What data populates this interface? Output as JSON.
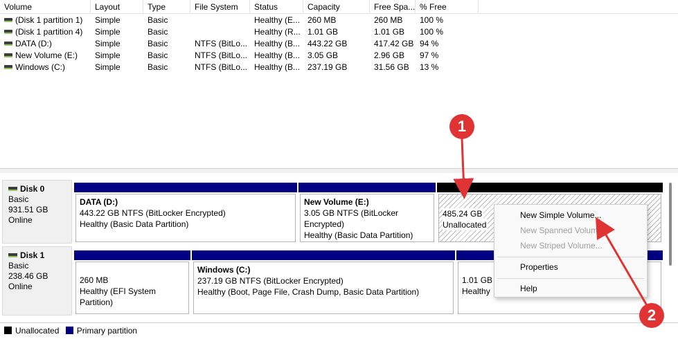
{
  "columns": [
    "Volume",
    "Layout",
    "Type",
    "File System",
    "Status",
    "Capacity",
    "Free Spa...",
    "% Free"
  ],
  "volumes": [
    {
      "volume": "(Disk 1 partition 1)",
      "layout": "Simple",
      "type": "Basic",
      "fs": "",
      "status": "Healthy (E...",
      "capacity": "260 MB",
      "free": "260 MB",
      "pct": "100 %"
    },
    {
      "volume": "(Disk 1 partition 4)",
      "layout": "Simple",
      "type": "Basic",
      "fs": "",
      "status": "Healthy (R...",
      "capacity": "1.01 GB",
      "free": "1.01 GB",
      "pct": "100 %"
    },
    {
      "volume": "DATA (D:)",
      "layout": "Simple",
      "type": "Basic",
      "fs": "NTFS (BitLo...",
      "status": "Healthy (B...",
      "capacity": "443.22 GB",
      "free": "417.42 GB",
      "pct": "94 %"
    },
    {
      "volume": "New Volume (E:)",
      "layout": "Simple",
      "type": "Basic",
      "fs": "NTFS (BitLo...",
      "status": "Healthy (B...",
      "capacity": "3.05 GB",
      "free": "2.96 GB",
      "pct": "97 %"
    },
    {
      "volume": "Windows (C:)",
      "layout": "Simple",
      "type": "Basic",
      "fs": "NTFS (BitLo...",
      "status": "Healthy (B...",
      "capacity": "237.19 GB",
      "free": "31.56 GB",
      "pct": "13 %"
    }
  ],
  "disk0": {
    "name": "Disk 0",
    "type": "Basic",
    "size": "931.51 GB",
    "state": "Online",
    "partitions": [
      {
        "title": "DATA  (D:)",
        "line1": "443.22 GB NTFS (BitLocker Encrypted)",
        "line2": "Healthy (Basic Data Partition)"
      },
      {
        "title": "New Volume  (E:)",
        "line1": "3.05 GB NTFS (BitLocker Encrypted)",
        "line2": "Healthy (Basic Data Partition)"
      },
      {
        "title": "",
        "line1": "485.24 GB",
        "line2": "Unallocated"
      }
    ]
  },
  "disk1": {
    "name": "Disk 1",
    "type": "Basic",
    "size": "238.46 GB",
    "state": "Online",
    "partitions": [
      {
        "title": "",
        "line1": "260 MB",
        "line2": "Healthy (EFI System Partition)"
      },
      {
        "title": "Windows  (C:)",
        "line1": "237.19 GB NTFS (BitLocker Encrypted)",
        "line2": "Healthy (Boot, Page File, Crash Dump, Basic Data Partition)"
      },
      {
        "title": "",
        "line1": "1.01 GB",
        "line2": "Healthy"
      }
    ]
  },
  "legend": [
    {
      "label": "Unallocated",
      "color": "#000000"
    },
    {
      "label": "Primary partition",
      "color": "#000080"
    }
  ],
  "context_menu": {
    "new_simple": "New Simple Volume...",
    "new_spanned": "New Spanned Volume...",
    "new_striped": "New Striped Volume...",
    "properties": "Properties",
    "help": "Help"
  },
  "annotations": {
    "badge1": "1",
    "badge2": "2",
    "color": "#e03333"
  }
}
